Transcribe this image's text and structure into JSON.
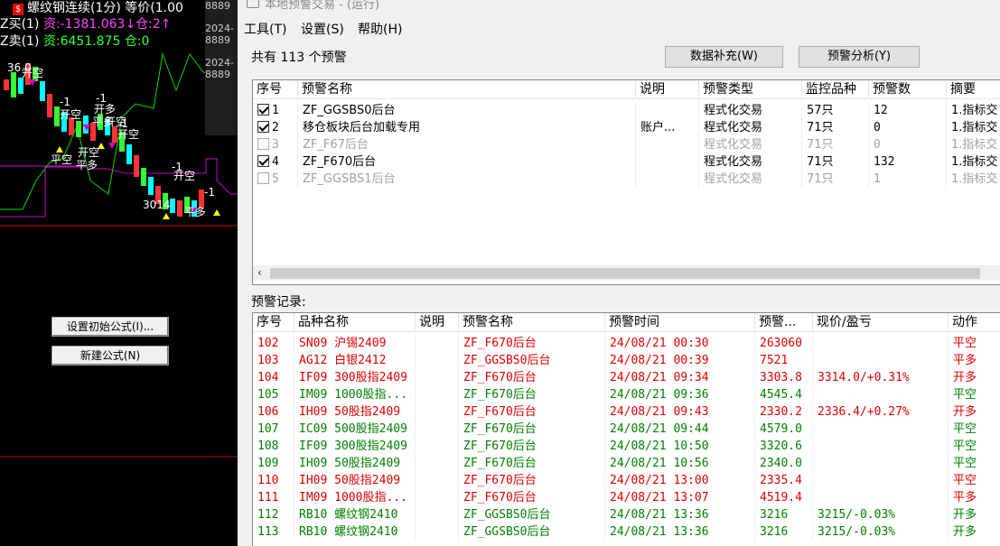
{
  "chart": {
    "title": "螺纹钢连续(1分) 等价(1.00",
    "buy_line_prefix": "Z买(1)",
    "buy_line_values": "资:-1381.063↓仓:2↑",
    "sell_line_prefix": "Z卖(1)",
    "sell_line_values": "资:6451.875 仓:0",
    "terminal": [
      "8889",
      "2024-",
      "8889",
      "2024-",
      "8889"
    ],
    "marks": [
      "36.0",
      "开空",
      "开空",
      "-1",
      "开空",
      "-1",
      "开多",
      "平多",
      "开空",
      "-1",
      "平空",
      "平多",
      "开空",
      "-1",
      "开空",
      "3014",
      "平多",
      "-1"
    ],
    "buttons": {
      "init_formula": "设置初始公式(I)...",
      "new_formula": "新建公式(N)"
    },
    "colors": {
      "up": "#ff3333",
      "down": "#33ff33",
      "cyan": "#00ffff",
      "yellow": "#ffff00",
      "magenta": "#cc00cc"
    }
  },
  "window": {
    "title": "本地预警交易 - (运行)",
    "menu": [
      "工具(T)",
      "设置(S)",
      "帮助(H)"
    ],
    "count_text": "共有 113 个预警",
    "buttons": {
      "data_supplement": "数据补充(W)",
      "analysis": "预警分析(Y)"
    },
    "alerts_table": {
      "headers": [
        "序号",
        "预警名称",
        "说明",
        "预警类型",
        "监控品种",
        "预警数",
        "摘要"
      ],
      "rows": [
        {
          "checked": true,
          "enabled": true,
          "no": "1",
          "name": "ZF_GGSBS0后台",
          "desc": "",
          "type": "程式化交易",
          "count_items": "57只",
          "alerts": "12",
          "summary": "1.指标交"
        },
        {
          "checked": true,
          "enabled": true,
          "no": "2",
          "name": "移仓板块后台加载专用",
          "desc": "账户...",
          "type": "程式化交易",
          "count_items": "71只",
          "alerts": "0",
          "summary": "1.指标交"
        },
        {
          "checked": false,
          "enabled": false,
          "no": "3",
          "name": "ZF_F67后台",
          "desc": "",
          "type": "程式化交易",
          "count_items": "71只",
          "alerts": "0",
          "summary": "1.指标交"
        },
        {
          "checked": true,
          "enabled": true,
          "no": "4",
          "name": "ZF_F670后台",
          "desc": "",
          "type": "程式化交易",
          "count_items": "71只",
          "alerts": "132",
          "summary": "1.指标交"
        },
        {
          "checked": false,
          "enabled": false,
          "no": "5",
          "name": "ZF_GGSBS1后台",
          "desc": "",
          "type": "程式化交易",
          "count_items": "71只",
          "alerts": "1",
          "summary": "1.指标交"
        }
      ]
    },
    "records_label": "预警记录:",
    "records_table": {
      "headers": [
        "序号",
        "品种名称",
        "说明",
        "预警名称",
        "预警时间",
        "预警...",
        "现价/盈亏",
        "动作"
      ],
      "rows": [
        {
          "no": "102",
          "symbol": "SN09 沪锡2409",
          "desc": "",
          "alert": "ZF_F670后台",
          "time": "24/08/21 00:30",
          "price": "263060",
          "pnl": "",
          "action": "平空",
          "color": "red"
        },
        {
          "no": "103",
          "symbol": "AG12 白银2412",
          "desc": "",
          "alert": "ZF_GGSBS0后台",
          "time": "24/08/21 00:39",
          "price": "7521",
          "pnl": "",
          "action": "平多",
          "color": "red"
        },
        {
          "no": "104",
          "symbol": "IF09 300股指2409",
          "desc": "",
          "alert": "ZF_F670后台",
          "time": "24/08/21 09:34",
          "price": "3303.8",
          "pnl": "3314.0/+0.31%",
          "action": "开多",
          "color": "red"
        },
        {
          "no": "105",
          "symbol": "IM09 1000股指...",
          "desc": "",
          "alert": "ZF_F670后台",
          "time": "24/08/21 09:36",
          "price": "4545.4",
          "pnl": "",
          "action": "平空",
          "color": "green"
        },
        {
          "no": "106",
          "symbol": "IH09 50股指2409",
          "desc": "",
          "alert": "ZF_F670后台",
          "time": "24/08/21 09:43",
          "price": "2330.2",
          "pnl": "2336.4/+0.27%",
          "action": "开多",
          "color": "red"
        },
        {
          "no": "107",
          "symbol": "IC09 500股指2409",
          "desc": "",
          "alert": "ZF_F670后台",
          "time": "24/08/21 09:44",
          "price": "4579.0",
          "pnl": "",
          "action": "平空",
          "color": "green"
        },
        {
          "no": "108",
          "symbol": "IF09 300股指2409",
          "desc": "",
          "alert": "ZF_F670后台",
          "time": "24/08/21 10:50",
          "price": "3320.6",
          "pnl": "",
          "action": "平空",
          "color": "green"
        },
        {
          "no": "109",
          "symbol": "IH09 50股指2409",
          "desc": "",
          "alert": "ZF_F670后台",
          "time": "24/08/21 10:56",
          "price": "2340.0",
          "pnl": "",
          "action": "平空",
          "color": "green"
        },
        {
          "no": "110",
          "symbol": "IH09 50股指2409",
          "desc": "",
          "alert": "ZF_F670后台",
          "time": "24/08/21 13:00",
          "price": "2335.4",
          "pnl": "",
          "action": "平空",
          "color": "red"
        },
        {
          "no": "111",
          "symbol": "IM09 1000股指...",
          "desc": "",
          "alert": "ZF_F670后台",
          "time": "24/08/21 13:07",
          "price": "4519.4",
          "pnl": "",
          "action": "平多",
          "color": "red"
        },
        {
          "no": "112",
          "symbol": "RB10 螺纹钢2410",
          "desc": "",
          "alert": "ZF_GGSBS0后台",
          "time": "24/08/21 13:36",
          "price": "3216",
          "pnl": "3215/-0.03%",
          "action": "开多",
          "color": "green"
        },
        {
          "no": "113",
          "symbol": "RB10 螺纹钢2410",
          "desc": "",
          "alert": "ZF_GGSBS0后台",
          "time": "24/08/21 13:36",
          "price": "3216",
          "pnl": "3215/-0.03%",
          "action": "开多",
          "color": "green"
        }
      ]
    }
  }
}
